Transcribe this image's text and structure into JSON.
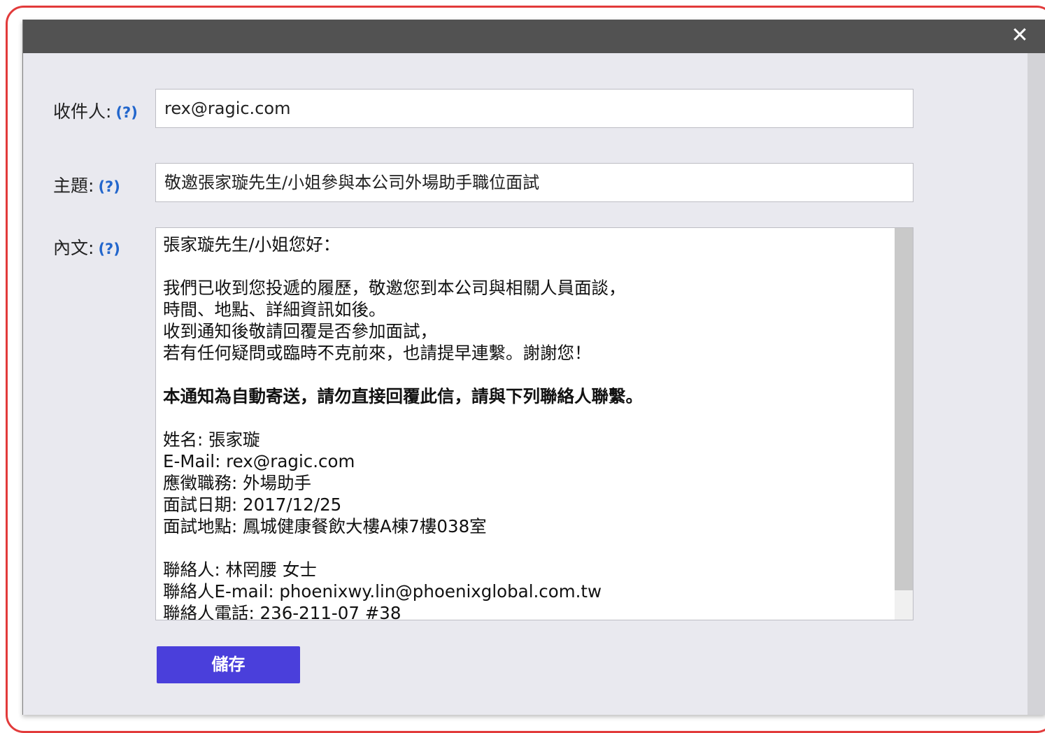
{
  "dialog": {
    "close_glyph": "✕"
  },
  "form": {
    "recipient": {
      "label": "收件人:",
      "help": "(?)",
      "value": "rex@ragic.com"
    },
    "subject": {
      "label": "主題:",
      "help": "(?)",
      "value": "敬邀張家璇先生/小姐參與本公司外場助手職位面試"
    },
    "body": {
      "label": "內文:",
      "help": "(?)",
      "lines": [
        "張家璇先生/小姐您好：",
        "",
        "我們已收到您投遞的履歷，敬邀您到本公司與相關人員面談，",
        "時間、地點、詳細資訊如後。",
        "收到通知後敬請回覆是否參加面試，",
        "若有任何疑問或臨時不克前來，也請提早連繫。謝謝您！",
        "",
        "本通知為自動寄送，請勿直接回覆此信，請與下列聯絡人聯繫。",
        "",
        "姓名: 張家璇",
        "E-Mail: rex@ragic.com",
        "應徵職務: 外場助手",
        "面試日期: 2017/12/25",
        "面試地點: 鳳城健康餐飲大樓A棟7樓038室",
        "",
        "聯絡人: 林罔腰 女士",
        "聯絡人E-mail: phoenixwy.lin@phoenixglobal.com.tw",
        "聯絡人電話: 236-211-07 #38"
      ],
      "scroll_position": 0
    },
    "save_label": "儲存"
  }
}
